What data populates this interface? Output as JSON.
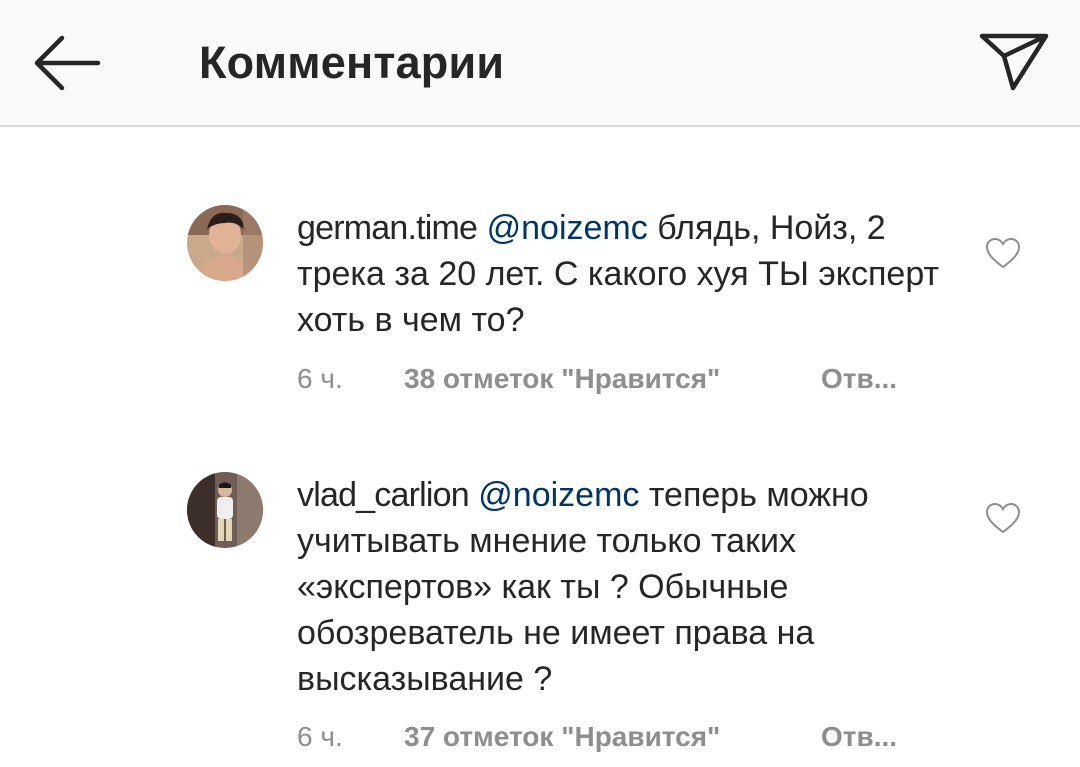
{
  "header": {
    "title": "Комментарии",
    "back_icon": "arrow-left-icon",
    "share_icon": "paper-plane-icon"
  },
  "comments": [
    {
      "username": "german.time",
      "mention": "@noizemc",
      "text": " блядь, Нойз, 2 трека за 20 лет. С какого хуя ТЫ эксперт хоть в чем то?",
      "time": "6 ч.",
      "likes": "38 отметок \"Нравится\"",
      "reply": "Отв..."
    },
    {
      "username": "vlad_carlion",
      "mention": "@noizemc",
      "text": " теперь можно учитывать мнение только таких «экспертов» как ты ? Обычные обозреватель не имеет права на высказывание ?",
      "time": "6 ч.",
      "likes": "37 отметок \"Нравится\"",
      "reply": "Отв..."
    }
  ],
  "colors": {
    "header_bg": "#fafafa",
    "text": "#262626",
    "mention": "#003569",
    "meta": "#8e8e8e"
  }
}
